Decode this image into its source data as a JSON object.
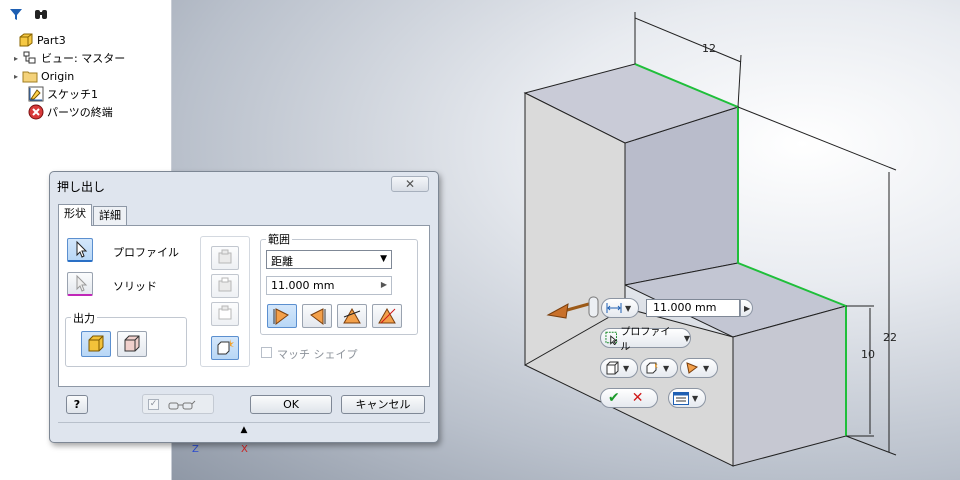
{
  "browser": {
    "items": [
      {
        "label": "Part3",
        "icon": "part-icon",
        "expander": ""
      },
      {
        "label": "ビュー: マスター",
        "icon": "view-icon",
        "expander": "▸"
      },
      {
        "label": "Origin",
        "icon": "folder-icon",
        "expander": "▸"
      },
      {
        "label": "スケッチ1",
        "icon": "sketch-icon",
        "expander": ""
      },
      {
        "label": "パーツの終端",
        "icon": "end-of-part-icon",
        "expander": ""
      }
    ]
  },
  "dialog": {
    "title": "押し出し",
    "close_label": "✕",
    "tabs": [
      {
        "label": "形状"
      },
      {
        "label": "詳細"
      }
    ],
    "profile_label": "プロファイル",
    "solid_label": "ソリッド",
    "output_label": "出力",
    "extents_label": "範囲",
    "extents_type": "距離",
    "distance_value": "11.000 mm",
    "match_shape_label": "マッチ シェイプ",
    "ok_label": "OK",
    "cancel_label": "キャンセル",
    "help_label": "?",
    "expand_label": "▲"
  },
  "viewport": {
    "dims": {
      "d12": "12",
      "d22": "22",
      "d10": "10"
    },
    "mini_toolbar": {
      "distance_value": "11.000 mm",
      "profile_label": "プロファイル"
    },
    "triad": {
      "z": "Z",
      "x": "X"
    }
  },
  "colors": {
    "accent_blue": "#2a70c6",
    "edge_green": "#1fbf3a",
    "face_light": "#d6d7d8",
    "face_top": "#c5c8d6",
    "ok_green": "#1a9a2a",
    "cancel_red": "#d01818"
  }
}
